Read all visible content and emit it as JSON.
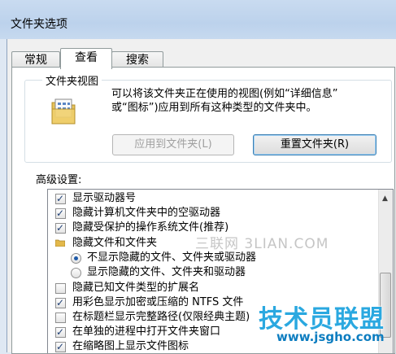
{
  "window": {
    "title": "文件夹选项"
  },
  "tabs": [
    {
      "label": "常规"
    },
    {
      "label": "查看"
    },
    {
      "label": "搜索"
    }
  ],
  "folder_views": {
    "heading": "文件夹视图",
    "desc_line1": "可以将该文件夹正在使用的视图(例如“详细信息”",
    "desc_line2": "或“图标”)应用到所有这种类型的文件夹中。",
    "apply_button": "应用到文件夹(L)",
    "reset_button": "重置文件夹(R)"
  },
  "advanced": {
    "label": "高级设置:",
    "items": [
      {
        "label": "显示驱动器号",
        "type": "checkbox",
        "checked": true
      },
      {
        "label": "隐藏计算机文件夹中的空驱动器",
        "type": "checkbox",
        "checked": true
      },
      {
        "label": "隐藏受保护的操作系统文件(推荐)",
        "type": "checkbox",
        "checked": true
      },
      {
        "label": "隐藏文件和文件夹",
        "type": "folder"
      },
      {
        "label": "不显示隐藏的文件、文件夹或驱动器",
        "type": "radio",
        "checked": true
      },
      {
        "label": "显示隐藏的文件、文件夹和驱动器",
        "type": "radio",
        "checked": false
      },
      {
        "label": "隐藏已知文件类型的扩展名",
        "type": "checkbox",
        "checked": false
      },
      {
        "label": "用彩色显示加密或压缩的 NTFS 文件",
        "type": "checkbox",
        "checked": true
      },
      {
        "label": "在标题栏显示完整路径(仅限经典主题)",
        "type": "checkbox",
        "checked": false
      },
      {
        "label": "在单独的进程中打开文件夹窗口",
        "type": "checkbox",
        "checked": true
      },
      {
        "label": "在缩略图上显示文件图标",
        "type": "checkbox",
        "checked": true
      }
    ]
  },
  "watermarks": {
    "line1": "三联网 3LIAN.COM",
    "line2": "技术员联盟",
    "line3": "www.jsgho.com"
  }
}
